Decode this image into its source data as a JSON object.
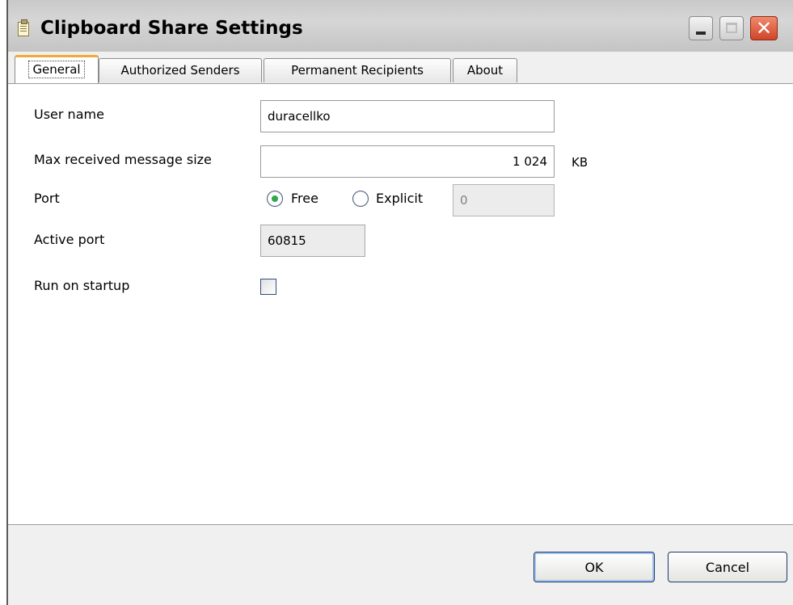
{
  "window": {
    "title": "Clipboard Share Settings",
    "minimize_glyph": "",
    "maximize_glyph": "",
    "close_glyph": "✕"
  },
  "tabs": [
    {
      "label": "General",
      "active": true
    },
    {
      "label": "Authorized Senders",
      "active": false
    },
    {
      "label": "Permanent Recipients",
      "active": false
    },
    {
      "label": "About",
      "active": false
    }
  ],
  "general": {
    "user_name_label": "User name",
    "user_name_value": "duracellko",
    "max_size_label": "Max received message size",
    "max_size_value": "1 024",
    "max_size_unit": "KB",
    "port_label": "Port",
    "port_free_label": "Free",
    "port_explicit_label": "Explicit",
    "port_explicit_value": "0",
    "port_mode": "Free",
    "active_port_label": "Active port",
    "active_port_value": "60815",
    "run_on_startup_label": "Run on startup",
    "run_on_startup_checked": false
  },
  "buttons": {
    "ok": "OK",
    "cancel": "Cancel"
  },
  "colors": {
    "active_tab_accent": "#f2a93b",
    "radio_selected": "#2fa84f",
    "close_button": "#d0442a"
  },
  "icons": {
    "title": "clipboard-icon",
    "minimize": "minimize-icon",
    "maximize": "maximize-icon",
    "close": "close-icon"
  }
}
